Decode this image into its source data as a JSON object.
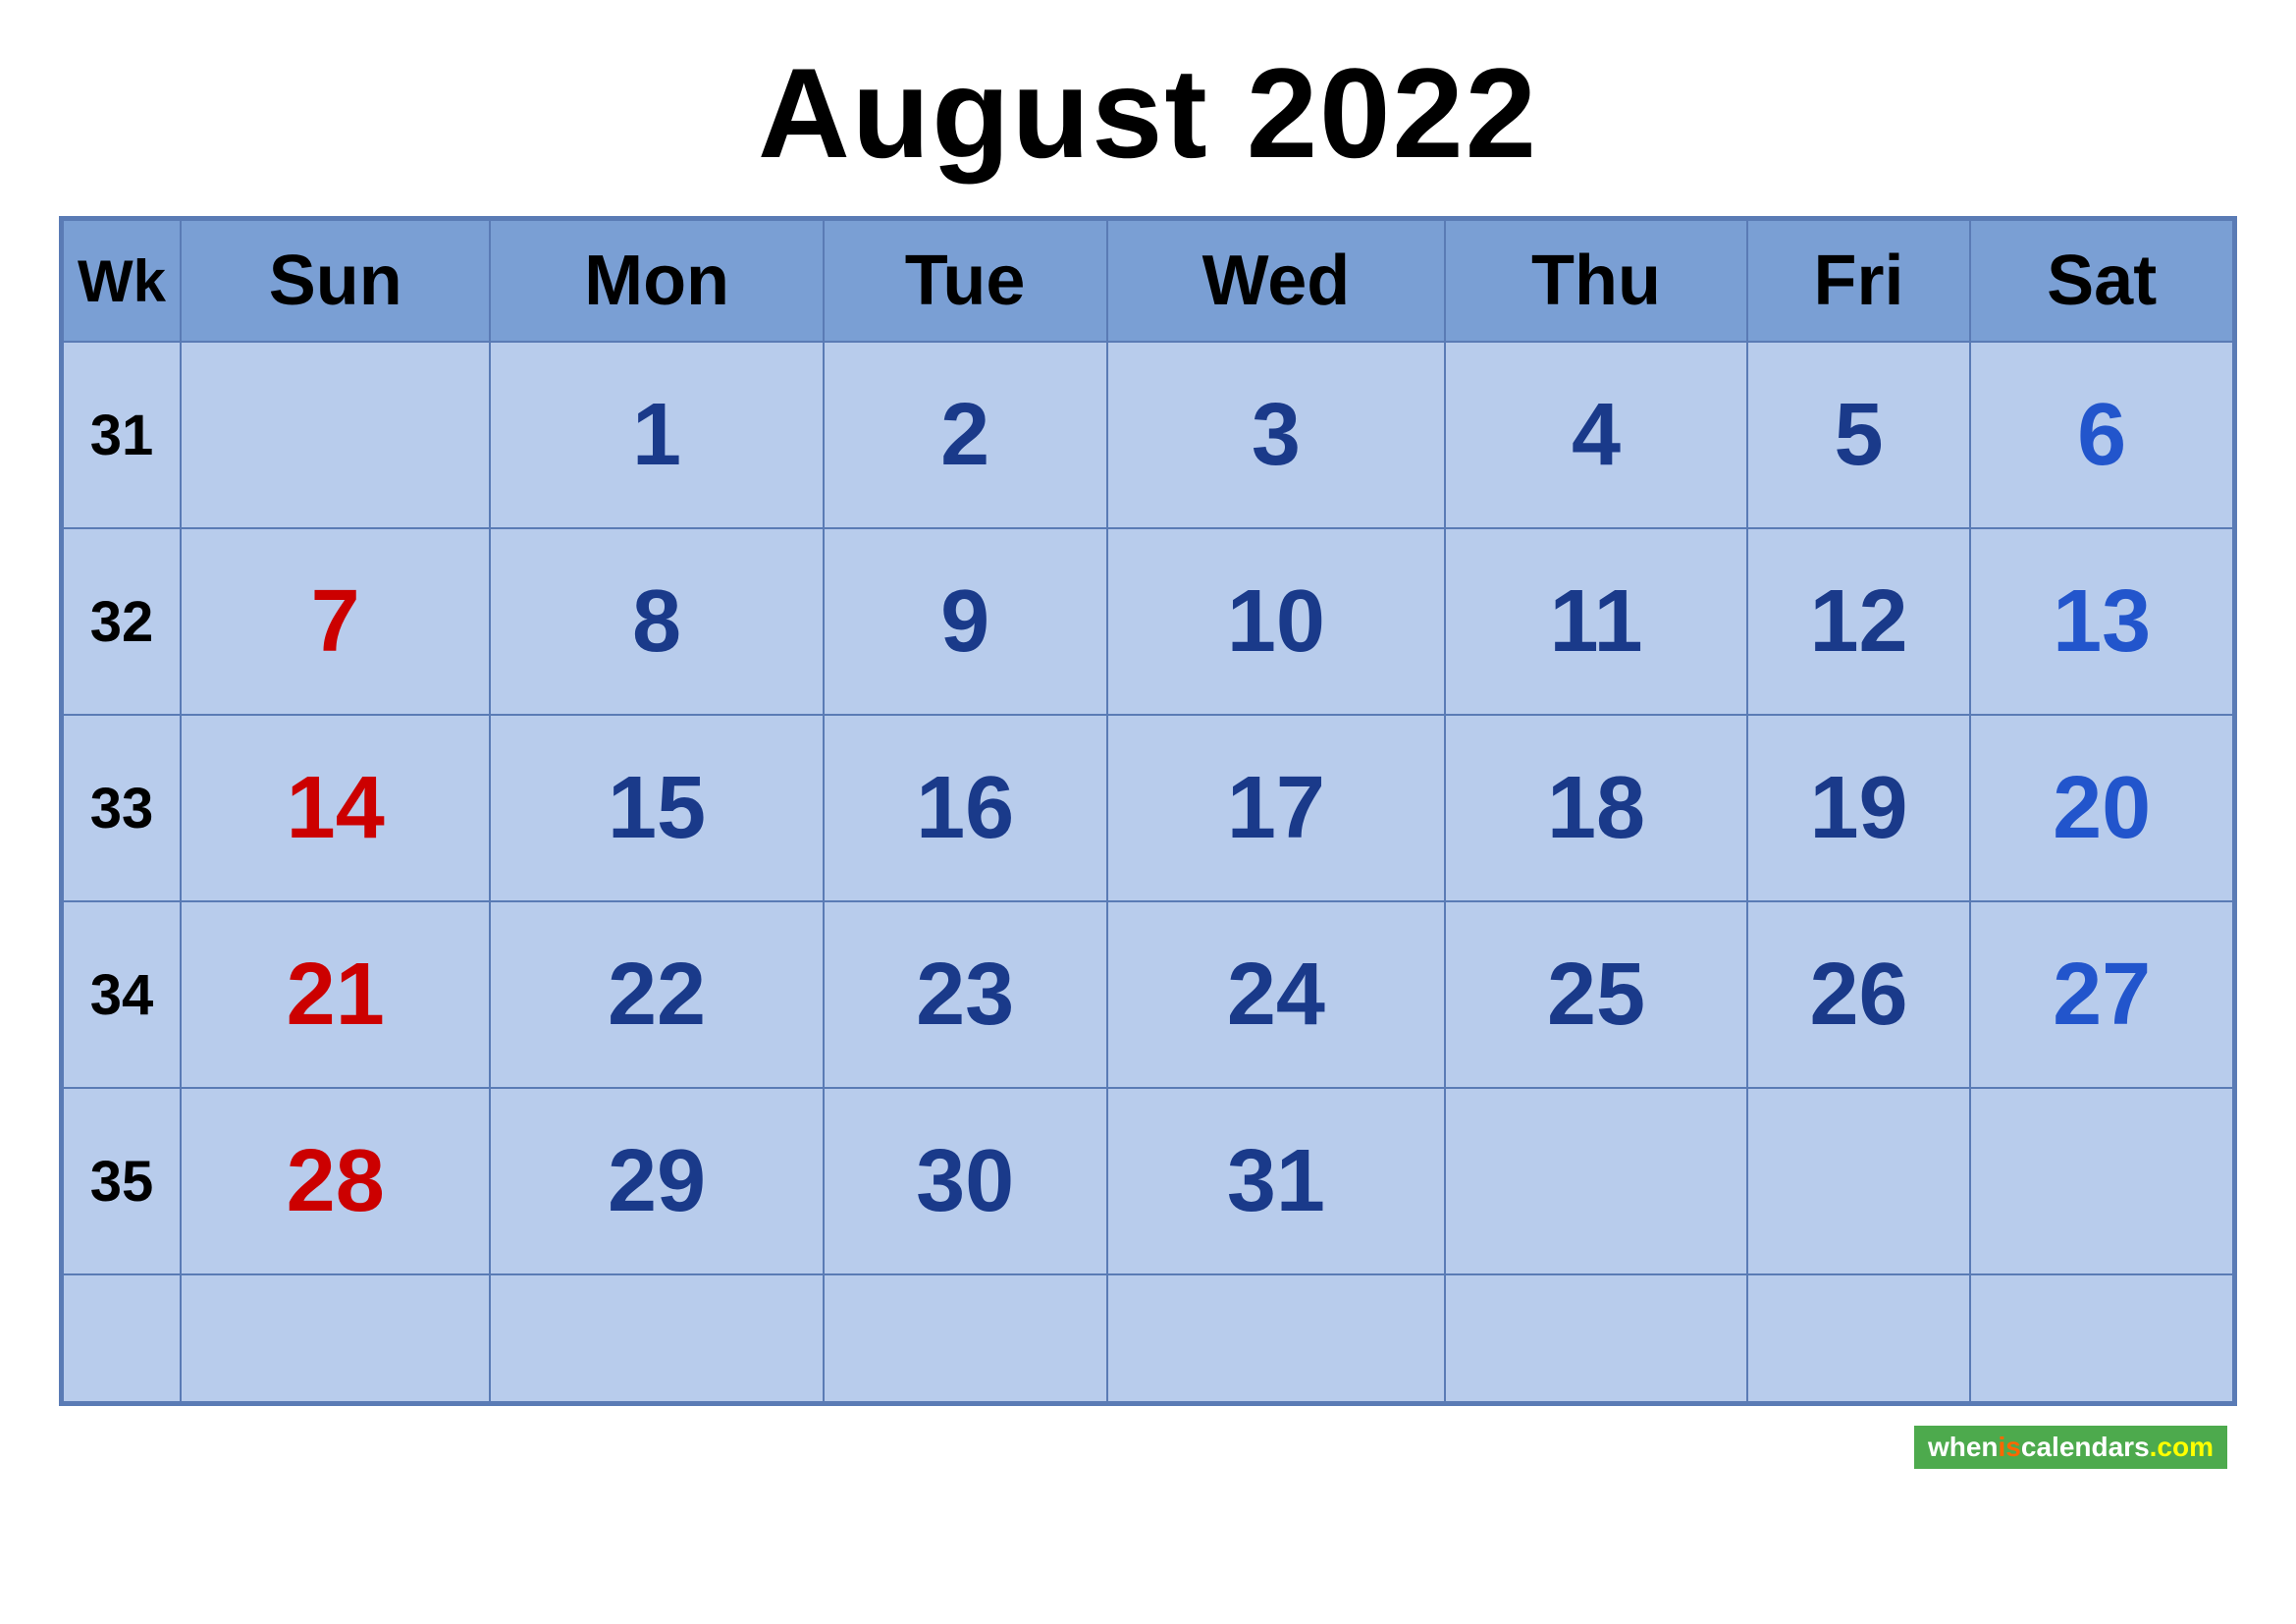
{
  "title": "August 2022",
  "header": {
    "columns": [
      {
        "label": "Wk",
        "key": "wk"
      },
      {
        "label": "Sun",
        "key": "sun"
      },
      {
        "label": "Mon",
        "key": "mon"
      },
      {
        "label": "Tue",
        "key": "tue"
      },
      {
        "label": "Wed",
        "key": "wed"
      },
      {
        "label": "Thu",
        "key": "thu"
      },
      {
        "label": "Fri",
        "key": "fri"
      },
      {
        "label": "Sat",
        "key": "sat"
      }
    ]
  },
  "weeks": [
    {
      "wk": "31",
      "sun": "",
      "mon": "1",
      "tue": "2",
      "wed": "3",
      "thu": "4",
      "fri": "5",
      "sat": "6"
    },
    {
      "wk": "32",
      "sun": "7",
      "mon": "8",
      "tue": "9",
      "wed": "10",
      "thu": "11",
      "fri": "12",
      "sat": "13"
    },
    {
      "wk": "33",
      "sun": "14",
      "mon": "15",
      "tue": "16",
      "wed": "17",
      "thu": "18",
      "fri": "19",
      "sat": "20"
    },
    {
      "wk": "34",
      "sun": "21",
      "mon": "22",
      "tue": "23",
      "wed": "24",
      "thu": "25",
      "fri": "26",
      "sat": "27"
    },
    {
      "wk": "35",
      "sun": "28",
      "mon": "29",
      "tue": "30",
      "wed": "31",
      "thu": "",
      "fri": "",
      "sat": ""
    }
  ],
  "footer": {
    "link_text": "wheniscalendars.com",
    "link_parts": {
      "when": "when",
      "is": "is",
      "calendars": "calendars",
      "com": ".com"
    }
  }
}
